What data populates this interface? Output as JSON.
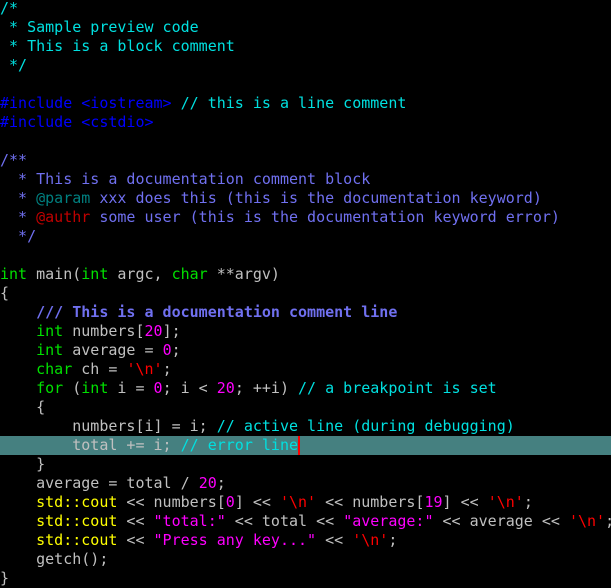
{
  "editor": {
    "language": "cpp",
    "theme_colors": {
      "background": "#000000",
      "default_text": "#c0c0c0",
      "comment": "#00e0e0",
      "preprocessor": "#0000ff",
      "doc_comment": "#7070f0",
      "doc_keyword": "#008080",
      "doc_keyword_error": "#c00000",
      "keyword": "#00e000",
      "number": "#ff00ff",
      "string": "#ff00ff",
      "char": "#ff0000",
      "library": "#ffff00",
      "error_line_background": "#458080",
      "caret": "#ff0000"
    },
    "lines": [
      {
        "kind": "normal",
        "tokens": [
          {
            "t": "comment",
            "v": "/*"
          }
        ]
      },
      {
        "kind": "normal",
        "tokens": [
          {
            "t": "comment",
            "v": " * Sample preview code"
          }
        ]
      },
      {
        "kind": "normal",
        "tokens": [
          {
            "t": "comment",
            "v": " * This is a block comment"
          }
        ]
      },
      {
        "kind": "normal",
        "tokens": [
          {
            "t": "comment",
            "v": " */"
          }
        ]
      },
      {
        "kind": "normal",
        "tokens": []
      },
      {
        "kind": "normal",
        "tokens": [
          {
            "t": "pp",
            "v": "#include <iostream>"
          },
          {
            "t": "plain",
            "v": " "
          },
          {
            "t": "comment",
            "v": "// this is a line comment"
          }
        ]
      },
      {
        "kind": "normal",
        "tokens": [
          {
            "t": "pp",
            "v": "#include <cstdio>"
          }
        ]
      },
      {
        "kind": "normal",
        "tokens": []
      },
      {
        "kind": "normal",
        "tokens": [
          {
            "t": "doc",
            "v": "/**"
          }
        ]
      },
      {
        "kind": "normal",
        "tokens": [
          {
            "t": "doc",
            "v": "  * This is a documentation comment block"
          }
        ]
      },
      {
        "kind": "normal",
        "tokens": [
          {
            "t": "doc",
            "v": "  * "
          },
          {
            "t": "doc-kw",
            "v": "@param"
          },
          {
            "t": "doc",
            "v": " xxx does this (this is the documentation keyword)"
          }
        ]
      },
      {
        "kind": "normal",
        "tokens": [
          {
            "t": "doc",
            "v": "  * "
          },
          {
            "t": "doc-kw-err",
            "v": "@authr"
          },
          {
            "t": "doc",
            "v": " some user (this is the documentation keyword error)"
          }
        ]
      },
      {
        "kind": "normal",
        "tokens": [
          {
            "t": "doc",
            "v": "  */"
          }
        ]
      },
      {
        "kind": "normal",
        "tokens": []
      },
      {
        "kind": "normal",
        "tokens": [
          {
            "t": "kw",
            "v": "int"
          },
          {
            "t": "plain",
            "v": " main("
          },
          {
            "t": "kw",
            "v": "int"
          },
          {
            "t": "plain",
            "v": " argc, "
          },
          {
            "t": "kw",
            "v": "char"
          },
          {
            "t": "plain",
            "v": " **argv)"
          }
        ]
      },
      {
        "kind": "normal",
        "tokens": [
          {
            "t": "plain",
            "v": "{"
          }
        ]
      },
      {
        "kind": "normal",
        "tokens": [
          {
            "t": "plain",
            "v": "    "
          },
          {
            "t": "doc-bold",
            "v": "/// This is a documentation comment line"
          }
        ]
      },
      {
        "kind": "normal",
        "tokens": [
          {
            "t": "plain",
            "v": "    "
          },
          {
            "t": "kw",
            "v": "int"
          },
          {
            "t": "plain",
            "v": " numbers["
          },
          {
            "t": "num",
            "v": "20"
          },
          {
            "t": "plain",
            "v": "];"
          }
        ]
      },
      {
        "kind": "normal",
        "tokens": [
          {
            "t": "plain",
            "v": "    "
          },
          {
            "t": "kw",
            "v": "int"
          },
          {
            "t": "plain",
            "v": " average = "
          },
          {
            "t": "num",
            "v": "0"
          },
          {
            "t": "plain",
            "v": ";"
          }
        ]
      },
      {
        "kind": "normal",
        "tokens": [
          {
            "t": "plain",
            "v": "    "
          },
          {
            "t": "kw",
            "v": "char"
          },
          {
            "t": "plain",
            "v": " ch = "
          },
          {
            "t": "char",
            "v": "'\\n'"
          },
          {
            "t": "plain",
            "v": ";"
          }
        ]
      },
      {
        "kind": "breakpoint",
        "tokens": [
          {
            "t": "plain",
            "v": "    "
          },
          {
            "t": "kw",
            "v": "for"
          },
          {
            "t": "plain",
            "v": " ("
          },
          {
            "t": "kw",
            "v": "int"
          },
          {
            "t": "plain",
            "v": " i = "
          },
          {
            "t": "num",
            "v": "0"
          },
          {
            "t": "plain",
            "v": "; i < "
          },
          {
            "t": "num",
            "v": "20"
          },
          {
            "t": "plain",
            "v": "; ++i) "
          },
          {
            "t": "comment",
            "v": "// a breakpoint is set"
          }
        ]
      },
      {
        "kind": "normal",
        "tokens": [
          {
            "t": "plain",
            "v": "    {"
          }
        ]
      },
      {
        "kind": "active",
        "tokens": [
          {
            "t": "plain",
            "v": "        numbers[i] = i; "
          },
          {
            "t": "comment",
            "v": "// active line (during debugging)"
          }
        ]
      },
      {
        "kind": "error",
        "caret": true,
        "tokens": [
          {
            "t": "plain",
            "v": "        total += i; "
          },
          {
            "t": "comment",
            "v": "// error line"
          }
        ]
      },
      {
        "kind": "normal",
        "tokens": [
          {
            "t": "plain",
            "v": "    }"
          }
        ]
      },
      {
        "kind": "normal",
        "tokens": [
          {
            "t": "plain",
            "v": "    average = total / "
          },
          {
            "t": "num",
            "v": "20"
          },
          {
            "t": "plain",
            "v": ";"
          }
        ]
      },
      {
        "kind": "normal",
        "tokens": [
          {
            "t": "plain",
            "v": "    "
          },
          {
            "t": "lib",
            "v": "std::cout"
          },
          {
            "t": "plain",
            "v": " << numbers["
          },
          {
            "t": "num",
            "v": "0"
          },
          {
            "t": "plain",
            "v": "] << "
          },
          {
            "t": "char",
            "v": "'\\n'"
          },
          {
            "t": "plain",
            "v": " << numbers["
          },
          {
            "t": "num",
            "v": "19"
          },
          {
            "t": "plain",
            "v": "] << "
          },
          {
            "t": "char",
            "v": "'\\n'"
          },
          {
            "t": "plain",
            "v": ";"
          }
        ]
      },
      {
        "kind": "normal",
        "tokens": [
          {
            "t": "plain",
            "v": "    "
          },
          {
            "t": "lib",
            "v": "std::cout"
          },
          {
            "t": "plain",
            "v": " << "
          },
          {
            "t": "str",
            "v": "\"total:\""
          },
          {
            "t": "plain",
            "v": " << total << "
          },
          {
            "t": "str",
            "v": "\"average:\""
          },
          {
            "t": "plain",
            "v": " << average << "
          },
          {
            "t": "char",
            "v": "'\\n'"
          },
          {
            "t": "plain",
            "v": ";"
          }
        ]
      },
      {
        "kind": "normal",
        "tokens": [
          {
            "t": "plain",
            "v": "    "
          },
          {
            "t": "lib",
            "v": "std::cout"
          },
          {
            "t": "plain",
            "v": " << "
          },
          {
            "t": "str",
            "v": "\"Press any key...\""
          },
          {
            "t": "plain",
            "v": " << "
          },
          {
            "t": "char",
            "v": "'\\n'"
          },
          {
            "t": "plain",
            "v": ";"
          }
        ]
      },
      {
        "kind": "normal",
        "tokens": [
          {
            "t": "plain",
            "v": "    getch();"
          }
        ]
      },
      {
        "kind": "normal",
        "tokens": [
          {
            "t": "plain",
            "v": "}"
          }
        ]
      }
    ]
  }
}
